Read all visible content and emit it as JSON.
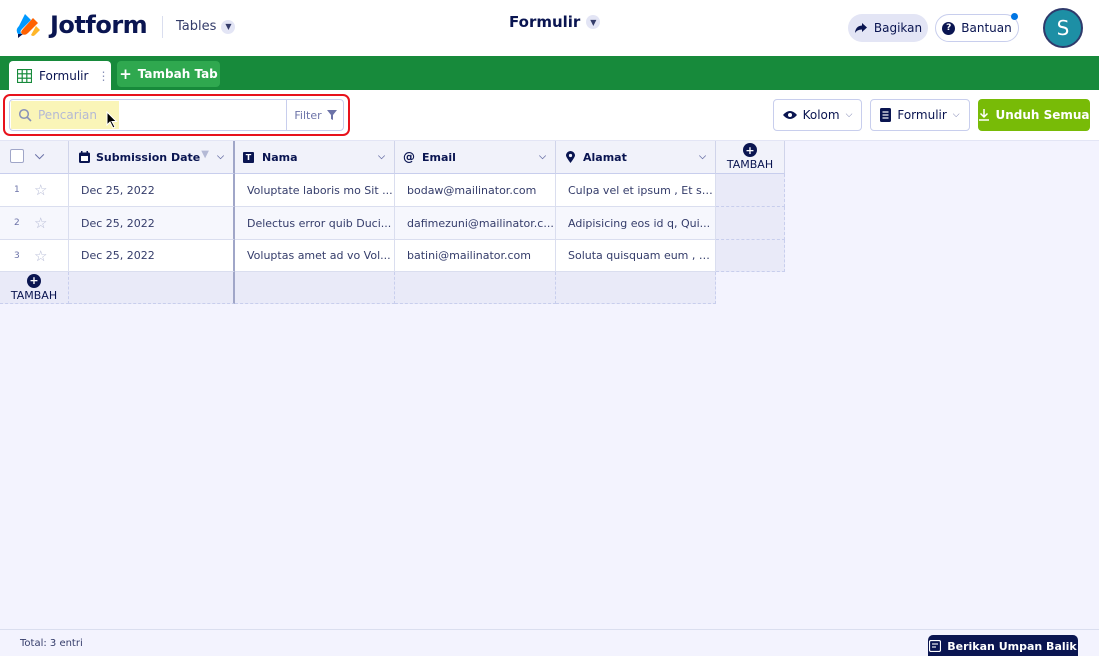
{
  "header": {
    "brand": "Jotform",
    "tables_menu": "Tables",
    "form_title": "Formulir",
    "share_label": "Bagikan",
    "help_label": "Bantuan",
    "avatar_initial": "S"
  },
  "tabs": {
    "active_tab": "Formulir",
    "add_tab": "Tambah Tab"
  },
  "toolbar": {
    "search_placeholder": "Pencarian",
    "filter_label": "Filter",
    "columns_label": "Kolom",
    "form_label": "Formulir",
    "download_label": "Unduh Semua"
  },
  "table": {
    "columns": [
      "Submission Date",
      "Nama",
      "Email",
      "Alamat"
    ],
    "add_column_label": "TAMBAH",
    "add_row_label": "TAMBAH",
    "rows": [
      {
        "num": "1",
        "date": "Dec 25, 2022",
        "name": "Voluptate laboris mo Sit ...",
        "email": "bodaw@mailinator.com",
        "address": "Culpa vel et ipsum , Et si..."
      },
      {
        "num": "2",
        "date": "Dec 25, 2022",
        "name": "Delectus error quib Duci...",
        "email": "dafimezuni@mailinator.c...",
        "address": "Adipisicing eos id q, Qui..."
      },
      {
        "num": "3",
        "date": "Dec 25, 2022",
        "name": "Voluptas amet ad vo Vol...",
        "email": "batini@mailinator.com",
        "address": "Soluta quisquam eum , E..."
      }
    ]
  },
  "footer": {
    "total": "Total: 3 entri",
    "feedback": "Berikan Umpan Balik"
  },
  "colors": {
    "brand_navy": "#0a1551",
    "tab_green": "#178a3b",
    "download_green": "#78bb07",
    "highlight_red": "#e8121c",
    "search_yellow": "#faf5b8"
  }
}
